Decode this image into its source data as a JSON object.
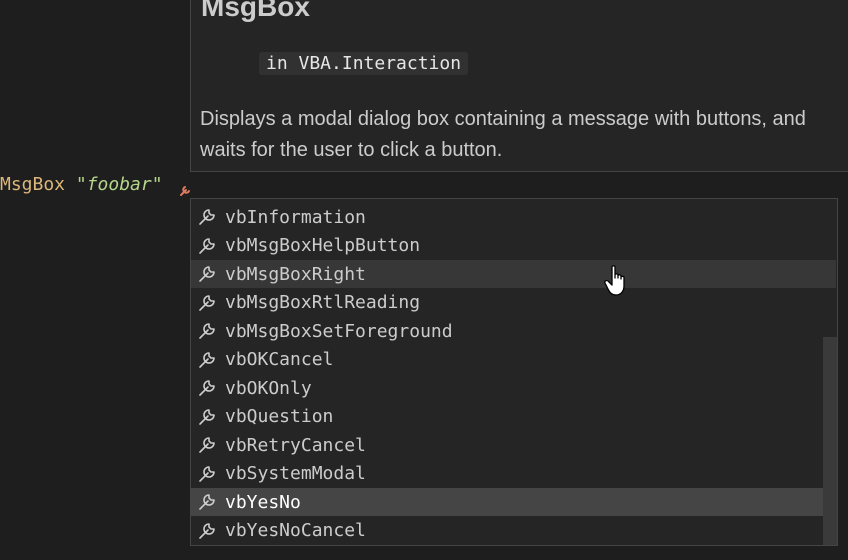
{
  "hover": {
    "title": "MsgBox",
    "namespace": "in VBA.Interaction",
    "description": "Displays a modal dialog box containing a message with buttons, and waits for the user to click a button."
  },
  "code": {
    "keyword": "MsgBox",
    "string": "\"foobar\""
  },
  "suggestions": {
    "icon": "wrench-icon",
    "hovered_index": 2,
    "selected_index": 10,
    "items": [
      "vbInformation",
      "vbMsgBoxHelpButton",
      "vbMsgBoxRight",
      "vbMsgBoxRtlReading",
      "vbMsgBoxSetForeground",
      "vbOKCancel",
      "vbOKOnly",
      "vbQuestion",
      "vbRetryCancel",
      "vbSystemModal",
      "vbYesNo",
      "vbYesNoCancel"
    ]
  },
  "colors": {
    "keyword": "#dcb67a",
    "string": "#b5d58d",
    "selection": "#454545",
    "hover": "#373737"
  }
}
